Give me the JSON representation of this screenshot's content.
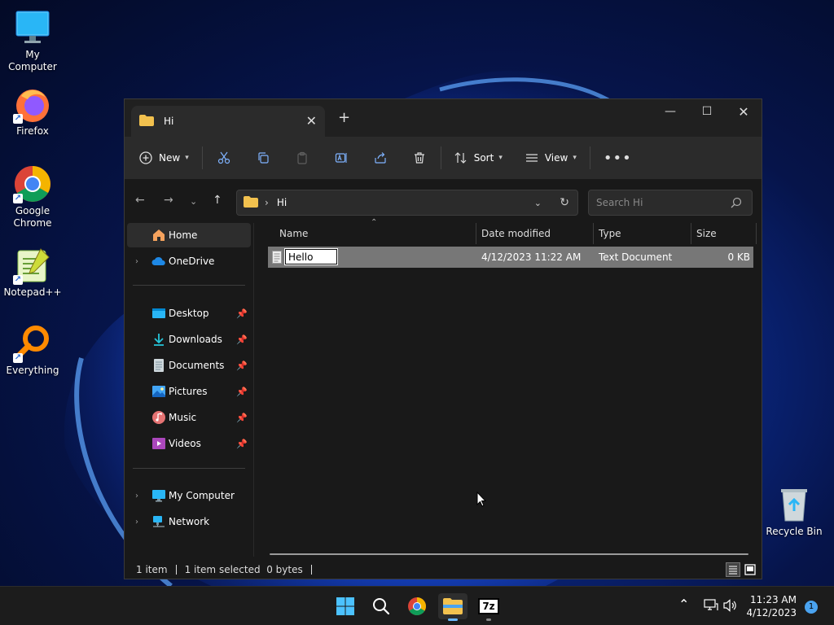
{
  "desktop": {
    "icons": [
      {
        "label": "My Computer"
      },
      {
        "label": "Firefox"
      },
      {
        "label": "Google Chrome"
      },
      {
        "label": "Notepad++"
      },
      {
        "label": "Everything"
      },
      {
        "label": "Recycle Bin"
      }
    ]
  },
  "explorer": {
    "tab_title": "Hi",
    "toolbar": {
      "new_label": "New",
      "sort_label": "Sort",
      "view_label": "View"
    },
    "address": {
      "crumb": "Hi",
      "separator": "›"
    },
    "search": {
      "placeholder": "Search Hi"
    },
    "navpane": {
      "home": "Home",
      "onedrive": "OneDrive",
      "quick": [
        {
          "label": "Desktop"
        },
        {
          "label": "Downloads"
        },
        {
          "label": "Documents"
        },
        {
          "label": "Pictures"
        },
        {
          "label": "Music"
        },
        {
          "label": "Videos"
        }
      ],
      "my_computer": "My Computer",
      "network": "Network"
    },
    "columns": {
      "name": "Name",
      "date": "Date modified",
      "type": "Type",
      "size": "Size"
    },
    "files": [
      {
        "name": "Hello",
        "date": "4/12/2023 11:22 AM",
        "type": "Text Document",
        "size": "0 KB"
      }
    ],
    "status": {
      "count": "1 item",
      "selected": "1 item selected  0 bytes"
    }
  },
  "taskbar": {
    "time": "11:23 AM",
    "date": "4/12/2023",
    "notifications": "1",
    "sevenzip_label": "7z"
  },
  "colors": {
    "accent": "#4aa3f0",
    "folder": "#f2c14e",
    "selection": "#777777"
  }
}
